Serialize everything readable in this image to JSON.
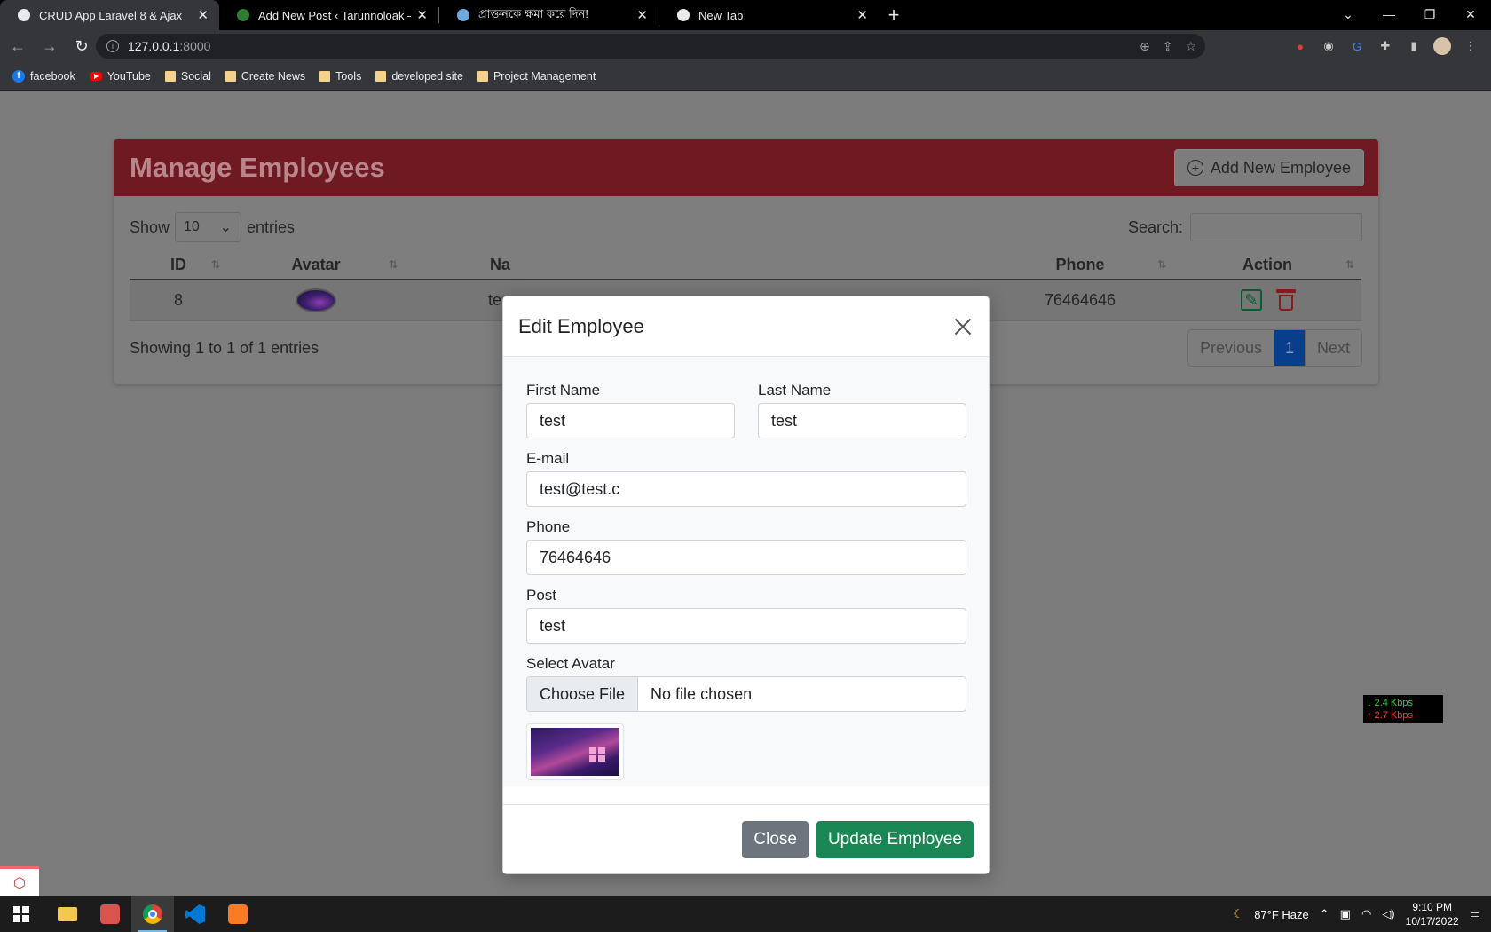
{
  "browser": {
    "tabs": [
      {
        "title": "CRUD App Laravel 8 & Ajax",
        "favicon_color": "#e8eaed",
        "active": true
      },
      {
        "title": "Add New Post ‹ Tarunnoloak — W",
        "favicon_color": "#2e7d32",
        "active": false
      },
      {
        "title": "প্রাক্তনকে ক্ষমা করে দিন!",
        "favicon_color": "#6fa8dc",
        "active": false
      },
      {
        "title": "New Tab",
        "favicon_color": "#e8eaed",
        "active": false
      }
    ],
    "url_host": "127.0.0.1",
    "url_port": ":8000",
    "bookmarks": [
      "facebook",
      "YouTube",
      "Social",
      "Create News",
      "Tools",
      "developed site",
      "Project Management"
    ]
  },
  "page": {
    "title": "Manage Employees",
    "add_button": "Add New Employee",
    "show_label": "Show",
    "length_value": "10",
    "entries_label": "entries",
    "search_label": "Search:",
    "columns": [
      "ID",
      "Avatar",
      "Na",
      "Phone",
      "Action"
    ],
    "row": {
      "id": "8",
      "name": "tes",
      "phone": "76464646"
    },
    "info": "Showing 1 to 1 of 1 entries",
    "pager": {
      "prev": "Previous",
      "current": "1",
      "next": "Next"
    }
  },
  "modal": {
    "title": "Edit Employee",
    "first_name_label": "First Name",
    "first_name_value": "test",
    "last_name_label": "Last Name",
    "last_name_value": "test",
    "email_label": "E-mail",
    "email_value": "test@test.c",
    "phone_label": "Phone",
    "phone_value": "76464646",
    "post_label": "Post",
    "post_value": "test",
    "avatar_label": "Select Avatar",
    "choose_file": "Choose File",
    "no_file": "No file chosen",
    "close_button": "Close",
    "update_button": "Update Employee"
  },
  "netmeter": {
    "down": "↓ 2.4 Kbps",
    "up": "↑ 2.7 Kbps"
  },
  "taskbar": {
    "weather": "87°F  Haze",
    "time": "9:10 PM",
    "date": "10/17/2022"
  },
  "colors": {
    "card_header": "#6f1a22",
    "update_btn": "#198754",
    "close_btn": "#6c757d",
    "pager_active": "#073f8c"
  }
}
